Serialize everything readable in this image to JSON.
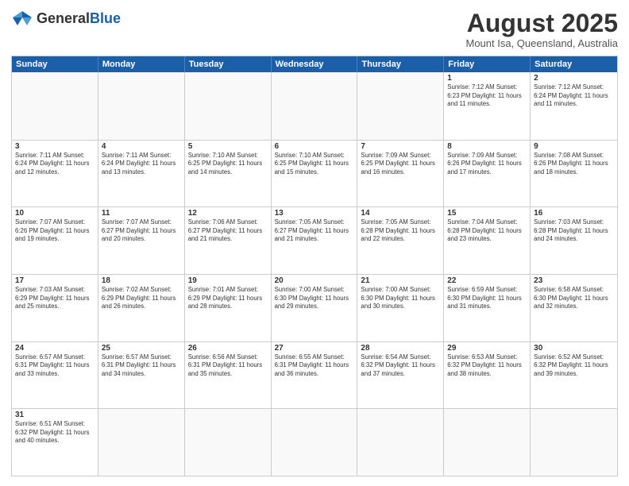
{
  "header": {
    "logo_general": "General",
    "logo_blue": "Blue",
    "month_title": "August 2025",
    "location": "Mount Isa, Queensland, Australia"
  },
  "days_of_week": [
    "Sunday",
    "Monday",
    "Tuesday",
    "Wednesday",
    "Thursday",
    "Friday",
    "Saturday"
  ],
  "weeks": [
    [
      {
        "day": "",
        "info": ""
      },
      {
        "day": "",
        "info": ""
      },
      {
        "day": "",
        "info": ""
      },
      {
        "day": "",
        "info": ""
      },
      {
        "day": "",
        "info": ""
      },
      {
        "day": "1",
        "info": "Sunrise: 7:12 AM\nSunset: 6:23 PM\nDaylight: 11 hours\nand 11 minutes."
      },
      {
        "day": "2",
        "info": "Sunrise: 7:12 AM\nSunset: 6:24 PM\nDaylight: 11 hours\nand 11 minutes."
      }
    ],
    [
      {
        "day": "3",
        "info": "Sunrise: 7:11 AM\nSunset: 6:24 PM\nDaylight: 11 hours\nand 12 minutes."
      },
      {
        "day": "4",
        "info": "Sunrise: 7:11 AM\nSunset: 6:24 PM\nDaylight: 11 hours\nand 13 minutes."
      },
      {
        "day": "5",
        "info": "Sunrise: 7:10 AM\nSunset: 6:25 PM\nDaylight: 11 hours\nand 14 minutes."
      },
      {
        "day": "6",
        "info": "Sunrise: 7:10 AM\nSunset: 6:25 PM\nDaylight: 11 hours\nand 15 minutes."
      },
      {
        "day": "7",
        "info": "Sunrise: 7:09 AM\nSunset: 6:25 PM\nDaylight: 11 hours\nand 16 minutes."
      },
      {
        "day": "8",
        "info": "Sunrise: 7:09 AM\nSunset: 6:26 PM\nDaylight: 11 hours\nand 17 minutes."
      },
      {
        "day": "9",
        "info": "Sunrise: 7:08 AM\nSunset: 6:26 PM\nDaylight: 11 hours\nand 18 minutes."
      }
    ],
    [
      {
        "day": "10",
        "info": "Sunrise: 7:07 AM\nSunset: 6:26 PM\nDaylight: 11 hours\nand 19 minutes."
      },
      {
        "day": "11",
        "info": "Sunrise: 7:07 AM\nSunset: 6:27 PM\nDaylight: 11 hours\nand 20 minutes."
      },
      {
        "day": "12",
        "info": "Sunrise: 7:06 AM\nSunset: 6:27 PM\nDaylight: 11 hours\nand 21 minutes."
      },
      {
        "day": "13",
        "info": "Sunrise: 7:05 AM\nSunset: 6:27 PM\nDaylight: 11 hours\nand 21 minutes."
      },
      {
        "day": "14",
        "info": "Sunrise: 7:05 AM\nSunset: 6:28 PM\nDaylight: 11 hours\nand 22 minutes."
      },
      {
        "day": "15",
        "info": "Sunrise: 7:04 AM\nSunset: 6:28 PM\nDaylight: 11 hours\nand 23 minutes."
      },
      {
        "day": "16",
        "info": "Sunrise: 7:03 AM\nSunset: 6:28 PM\nDaylight: 11 hours\nand 24 minutes."
      }
    ],
    [
      {
        "day": "17",
        "info": "Sunrise: 7:03 AM\nSunset: 6:29 PM\nDaylight: 11 hours\nand 25 minutes."
      },
      {
        "day": "18",
        "info": "Sunrise: 7:02 AM\nSunset: 6:29 PM\nDaylight: 11 hours\nand 26 minutes."
      },
      {
        "day": "19",
        "info": "Sunrise: 7:01 AM\nSunset: 6:29 PM\nDaylight: 11 hours\nand 28 minutes."
      },
      {
        "day": "20",
        "info": "Sunrise: 7:00 AM\nSunset: 6:30 PM\nDaylight: 11 hours\nand 29 minutes."
      },
      {
        "day": "21",
        "info": "Sunrise: 7:00 AM\nSunset: 6:30 PM\nDaylight: 11 hours\nand 30 minutes."
      },
      {
        "day": "22",
        "info": "Sunrise: 6:59 AM\nSunset: 6:30 PM\nDaylight: 11 hours\nand 31 minutes."
      },
      {
        "day": "23",
        "info": "Sunrise: 6:58 AM\nSunset: 6:30 PM\nDaylight: 11 hours\nand 32 minutes."
      }
    ],
    [
      {
        "day": "24",
        "info": "Sunrise: 6:57 AM\nSunset: 6:31 PM\nDaylight: 11 hours\nand 33 minutes."
      },
      {
        "day": "25",
        "info": "Sunrise: 6:57 AM\nSunset: 6:31 PM\nDaylight: 11 hours\nand 34 minutes."
      },
      {
        "day": "26",
        "info": "Sunrise: 6:56 AM\nSunset: 6:31 PM\nDaylight: 11 hours\nand 35 minutes."
      },
      {
        "day": "27",
        "info": "Sunrise: 6:55 AM\nSunset: 6:31 PM\nDaylight: 11 hours\nand 36 minutes."
      },
      {
        "day": "28",
        "info": "Sunrise: 6:54 AM\nSunset: 6:32 PM\nDaylight: 11 hours\nand 37 minutes."
      },
      {
        "day": "29",
        "info": "Sunrise: 6:53 AM\nSunset: 6:32 PM\nDaylight: 11 hours\nand 38 minutes."
      },
      {
        "day": "30",
        "info": "Sunrise: 6:52 AM\nSunset: 6:32 PM\nDaylight: 11 hours\nand 39 minutes."
      }
    ],
    [
      {
        "day": "31",
        "info": "Sunrise: 6:51 AM\nSunset: 6:32 PM\nDaylight: 11 hours\nand 40 minutes."
      },
      {
        "day": "",
        "info": ""
      },
      {
        "day": "",
        "info": ""
      },
      {
        "day": "",
        "info": ""
      },
      {
        "day": "",
        "info": ""
      },
      {
        "day": "",
        "info": ""
      },
      {
        "day": "",
        "info": ""
      }
    ]
  ]
}
